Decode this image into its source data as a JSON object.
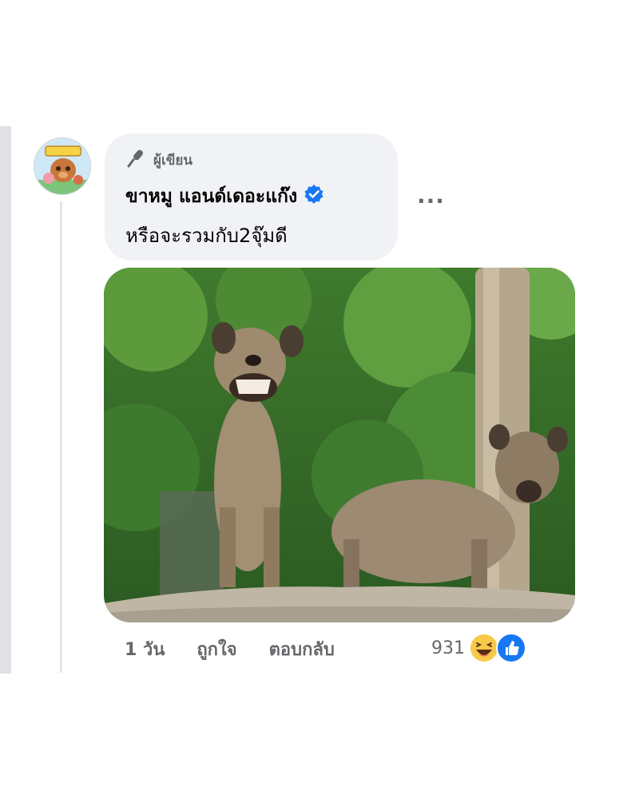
{
  "comment": {
    "author_badge": "ผู้เขียน",
    "author_name": "ขาหมู แอนด์เดอะแก๊ง",
    "verified": true,
    "text": "หรือจะรวมกับ2จุ๊มดี",
    "more_label": "...",
    "time": "1 วัน",
    "like_label": "ถูกใจ",
    "reply_label": "ตอบกลับ",
    "reaction_count": "931",
    "reactions": [
      "haha-icon",
      "like-icon"
    ]
  },
  "colors": {
    "bubble": "#f0f2f5",
    "verified": "#1877f2",
    "secondary_text": "#65676b"
  }
}
